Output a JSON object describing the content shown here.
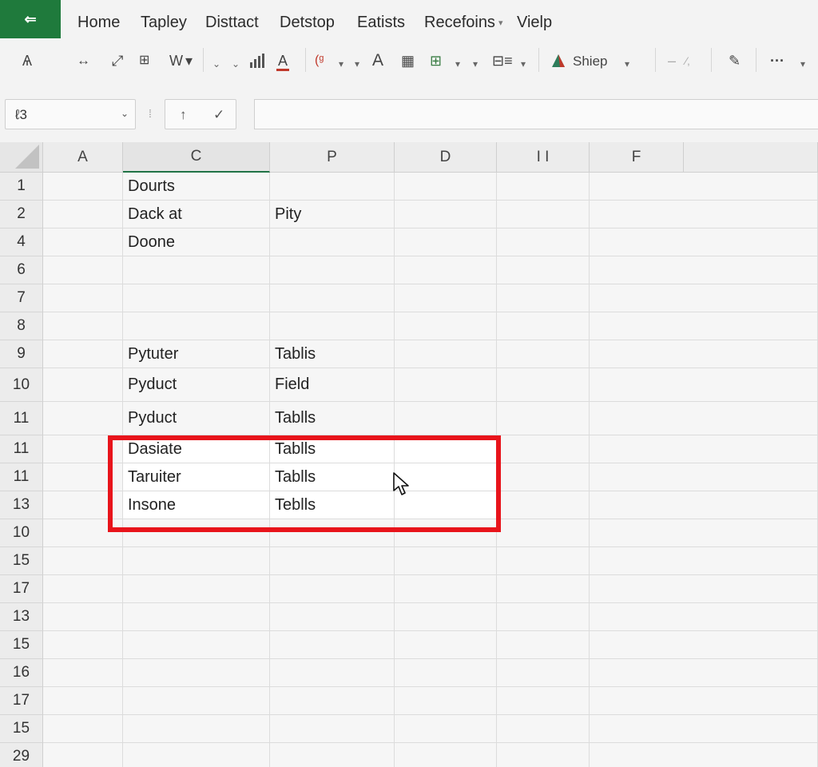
{
  "ribbon": {
    "app_icon": "⇐",
    "tabs": [
      "Home",
      "Tapley",
      "Disttact",
      "Detstop",
      "Eatists",
      "Recefoins",
      "Vielp"
    ],
    "dropdown_tab_index": 5
  },
  "toolbar": {
    "icons": [
      "format-painter-icon",
      "resize-icon",
      "diagonal-arrow-icon",
      "grid-icon",
      "chevron-down-icon",
      "bar-chart-icon",
      "font-color-icon",
      "paste-special-icon",
      "font-icon",
      "table-icon",
      "pivot-icon",
      "list-icon",
      "shape-icon",
      "pen-icon",
      "more-icon"
    ],
    "labels": {
      "painter": "Ѧ",
      "w_label": "W",
      "a_label": "A",
      "font_a": "A",
      "shape_label": "Shiep",
      "more": "···"
    }
  },
  "formula_bar": {
    "name_box_value": "ℓ3",
    "fx_left": "↑",
    "fx_right": "✓",
    "formula_value": ""
  },
  "grid": {
    "columns": [
      "A",
      "C",
      "P",
      "D",
      "I I",
      "F"
    ],
    "active_column_index": 1,
    "rows": [
      {
        "num": "1",
        "cells": [
          "",
          "Dourts",
          "",
          "",
          "",
          ""
        ]
      },
      {
        "num": "2",
        "cells": [
          "",
          "Dack at",
          "Pity",
          "",
          "",
          ""
        ]
      },
      {
        "num": "4",
        "cells": [
          "",
          "Doone",
          "",
          "",
          "",
          ""
        ]
      },
      {
        "num": "6",
        "cells": [
          "",
          "",
          "",
          "",
          "",
          ""
        ]
      },
      {
        "num": "7",
        "cells": [
          "",
          "",
          "",
          "",
          "",
          ""
        ]
      },
      {
        "num": "8",
        "cells": [
          "",
          "",
          "",
          "",
          "",
          ""
        ]
      },
      {
        "num": "9",
        "cells": [
          "",
          "Pytuter",
          "Tablis",
          "",
          "",
          ""
        ]
      },
      {
        "num": "10",
        "cells": [
          "",
          "Pyduct",
          "Field",
          "",
          "",
          ""
        ]
      },
      {
        "num": "11",
        "cells": [
          "",
          "Pyduct",
          "Tablls",
          "",
          "",
          ""
        ]
      },
      {
        "num": "11",
        "cells": [
          "",
          "Dasiate",
          "Tablls",
          "",
          "",
          ""
        ]
      },
      {
        "num": "11",
        "cells": [
          "",
          "Taruiter",
          "Tablls",
          "",
          "",
          ""
        ]
      },
      {
        "num": "13",
        "cells": [
          "",
          "Insone",
          "Teblls",
          "",
          "",
          ""
        ]
      },
      {
        "num": "10",
        "cells": [
          "",
          "",
          "",
          "",
          "",
          ""
        ]
      },
      {
        "num": "15",
        "cells": [
          "",
          "",
          "",
          "",
          "",
          ""
        ]
      },
      {
        "num": "17",
        "cells": [
          "",
          "",
          "",
          "",
          "",
          ""
        ]
      },
      {
        "num": "13",
        "cells": [
          "",
          "",
          "",
          "",
          "",
          ""
        ]
      },
      {
        "num": "15",
        "cells": [
          "",
          "",
          "",
          "",
          "",
          ""
        ]
      },
      {
        "num": "16",
        "cells": [
          "",
          "",
          "",
          "",
          "",
          ""
        ]
      },
      {
        "num": "17",
        "cells": [
          "",
          "",
          "",
          "",
          "",
          ""
        ]
      },
      {
        "num": "15",
        "cells": [
          "",
          "",
          "",
          "",
          "",
          ""
        ]
      },
      {
        "num": "29",
        "cells": [
          "",
          "",
          "",
          "",
          "",
          ""
        ]
      }
    ],
    "highlighted_rows": [
      9,
      10,
      11
    ]
  },
  "colors": {
    "accent": "#217346",
    "app_button": "#1f7a3c",
    "selection_outline": "#e8141b"
  }
}
